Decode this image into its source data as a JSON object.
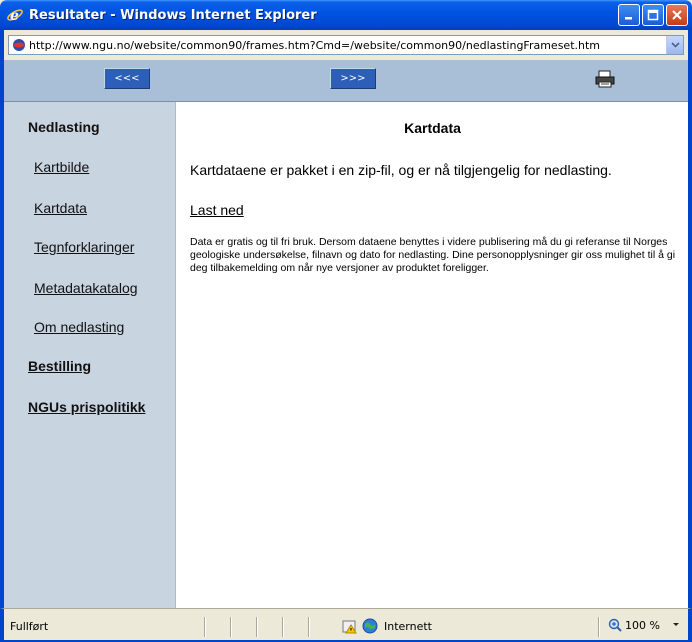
{
  "window": {
    "title": "Resultater - Windows Internet Explorer"
  },
  "address": {
    "url": "http://www.ngu.no/website/common90/frames.htm?Cmd=/website/common90/nedlastingFrameset.htm"
  },
  "toolbar": {
    "back_label": "<<<",
    "forward_label": ">>>",
    "print_icon": "printer-icon"
  },
  "sidebar": {
    "heading": "Nedlasting",
    "items": [
      {
        "label": "Kartbilde"
      },
      {
        "label": "Kartdata"
      },
      {
        "label": "Tegnforklaringer"
      },
      {
        "label": "Metadatakatalog"
      },
      {
        "label": "Om nedlasting"
      }
    ],
    "sections": [
      {
        "label": "Bestilling"
      },
      {
        "label": "NGUs prispolitikk"
      }
    ]
  },
  "content": {
    "title": "Kartdata",
    "intro": "Kartdataene er pakket i en zip-fil, og er nå tilgjengelig for nedlasting.",
    "download_link": "Last ned",
    "disclaimer": "Data er gratis og til fri bruk. Dersom dataene benyttes i videre publisering må du gi referanse til Norges geologiske undersøkelse, filnavn og dato for nedlasting. Dine personopplysninger gir oss mulighet til å gi deg tilbakemelding om når nye versjoner av produktet foreligger."
  },
  "statusbar": {
    "status": "Fullført",
    "zone": "Internett",
    "zoom": "100 %"
  },
  "colors": {
    "titlebar": "#0054e3",
    "frame_border": "#0044cc",
    "sidebar_bg": "#c9d4e1",
    "navstrip_bg": "#a9bfd7",
    "nav_button": "#2d5fb8"
  }
}
